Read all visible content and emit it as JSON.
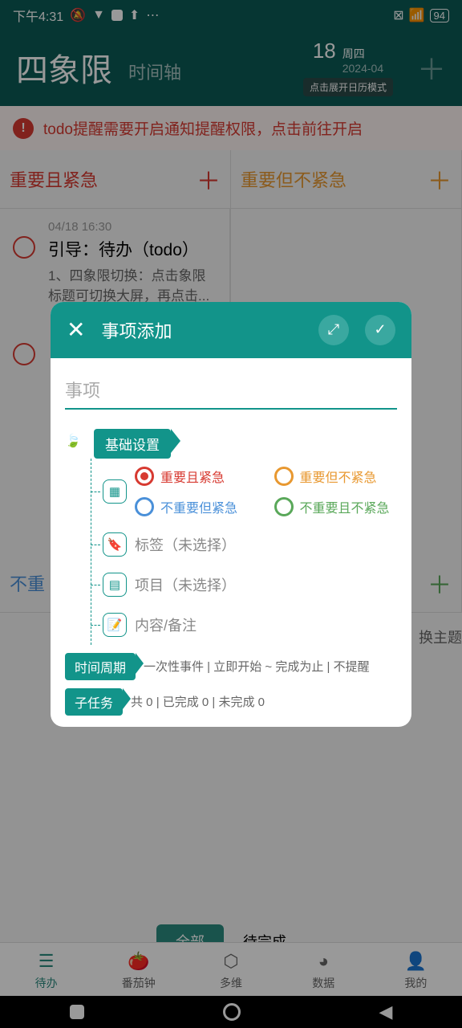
{
  "status": {
    "time": "下午4:31",
    "battery": "94"
  },
  "header": {
    "title": "四象限",
    "sub": "时间轴",
    "day": "18",
    "weekday": "周四",
    "ym": "2024-04",
    "hint": "点击展开日历模式"
  },
  "warning": {
    "text": "todo提醒需要开启通知提醒权限，点击前往开启"
  },
  "quadrants": {
    "q1": "重要且紧急",
    "q2": "重要但不紧急",
    "q3": "不重要但紧急",
    "q4": "不重要且不紧急"
  },
  "todo": {
    "time": "04/18 16:30",
    "title": "引导：待办（todo）",
    "desc": "1、四象限切换：点击象限标题可切换大屏，再点击..."
  },
  "filters": {
    "all": "全部",
    "pending": "待完成"
  },
  "nav": {
    "todo": "待办",
    "pomodoro": "番茄钟",
    "multi": "多维",
    "data": "数据",
    "mine": "我的"
  },
  "modal": {
    "title": "事项添加",
    "input_placeholder": "事项",
    "section_basic": "基础设置",
    "priority": {
      "p1": "重要且紧急",
      "p2": "重要但不紧急",
      "p3": "不重要但紧急",
      "p4": "不重要且不紧急"
    },
    "tag": "标签（未选择）",
    "project": "项目（未选择）",
    "content": "内容/备注",
    "time_section": "时间周期",
    "time_text": "一次性事件 | 立即开始 ~ 完成为止 | 不提醒",
    "subtask_section": "子任务",
    "subtask_text": "共 0 | 已完成 0 | 未完成 0"
  },
  "theme_hint": "换主题"
}
